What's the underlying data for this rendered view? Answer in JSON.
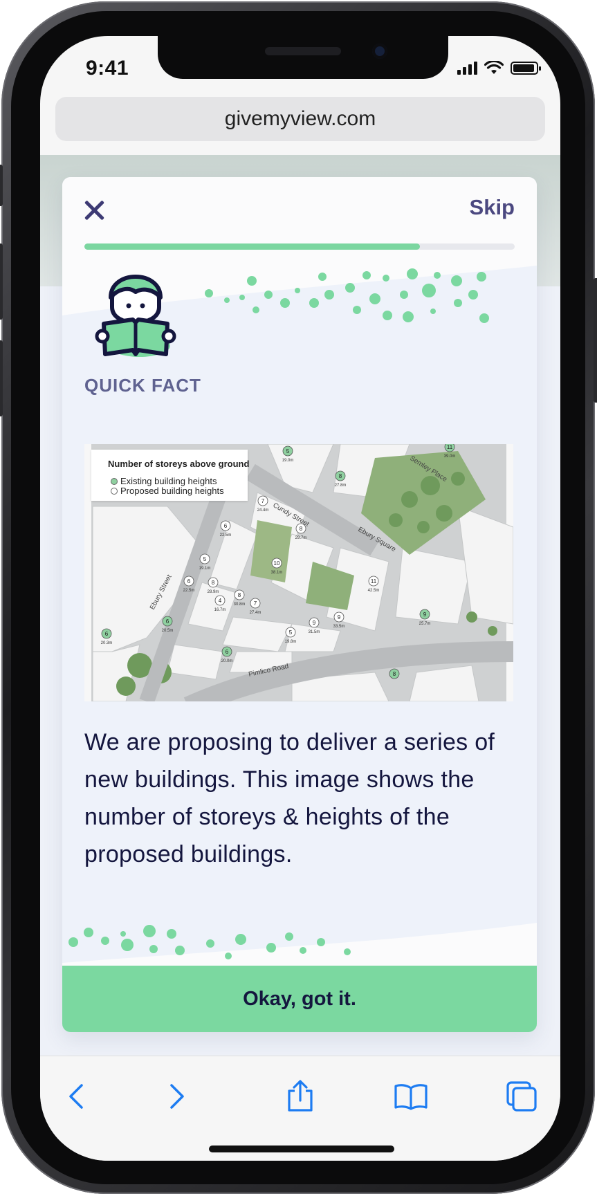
{
  "status_bar": {
    "time": "9:41"
  },
  "browser": {
    "address": "givemyview.com"
  },
  "modal": {
    "skip_label": "Skip",
    "progress": 0.78,
    "kicker": "QUICK FACT",
    "map": {
      "legend_title": "Number of storeys above ground",
      "legend_items": [
        "Existing building heights",
        "Proposed building heights"
      ],
      "streets": [
        "Cundy Street",
        "Semley Place",
        "Ebury Street",
        "Ebury Square",
        "Pimlico Road"
      ],
      "markers": [
        {
          "storeys": "5",
          "height": "19.0m"
        },
        {
          "storeys": "11",
          "height": "39.0m"
        },
        {
          "storeys": "8",
          "height": "27.8m"
        },
        {
          "storeys": "7",
          "height": "24.4m"
        },
        {
          "storeys": "6",
          "height": "22.5m"
        },
        {
          "storeys": "8",
          "height": "29.7m"
        },
        {
          "storeys": "5",
          "height": "19.1m"
        },
        {
          "storeys": "10",
          "height": "38.1m"
        },
        {
          "storeys": "6",
          "height": "22.5m"
        },
        {
          "storeys": "8",
          "height": "28.9m"
        },
        {
          "storeys": "4",
          "height": "16.7m"
        },
        {
          "storeys": "8",
          "height": "30.8m"
        },
        {
          "storeys": "7",
          "height": "27.4m"
        },
        {
          "storeys": "11",
          "height": "42.5m"
        },
        {
          "storeys": "6",
          "height": "20.5m"
        },
        {
          "storeys": "6",
          "height": "20.3m"
        },
        {
          "storeys": "9",
          "height": "33.5m"
        },
        {
          "storeys": "9",
          "height": "31.5m"
        },
        {
          "storeys": "5",
          "height": "19.8m"
        },
        {
          "storeys": "6",
          "height": "20.0m"
        },
        {
          "storeys": "9",
          "height": "25.7m"
        },
        {
          "storeys": "8",
          "height": ""
        }
      ]
    },
    "body": "We are proposing to deliver a series of new buildings. This image shows the number of storeys & heights of the proposed buildings.",
    "cta_label": "Okay, got it."
  },
  "colors": {
    "accent": "#7bd8a0",
    "ink": "#14163e",
    "brand": "#3d3a74",
    "safari_blue": "#1d7cf2"
  },
  "toolbar_icons": [
    "back-icon",
    "forward-icon",
    "share-icon",
    "bookmarks-icon",
    "tabs-icon"
  ]
}
